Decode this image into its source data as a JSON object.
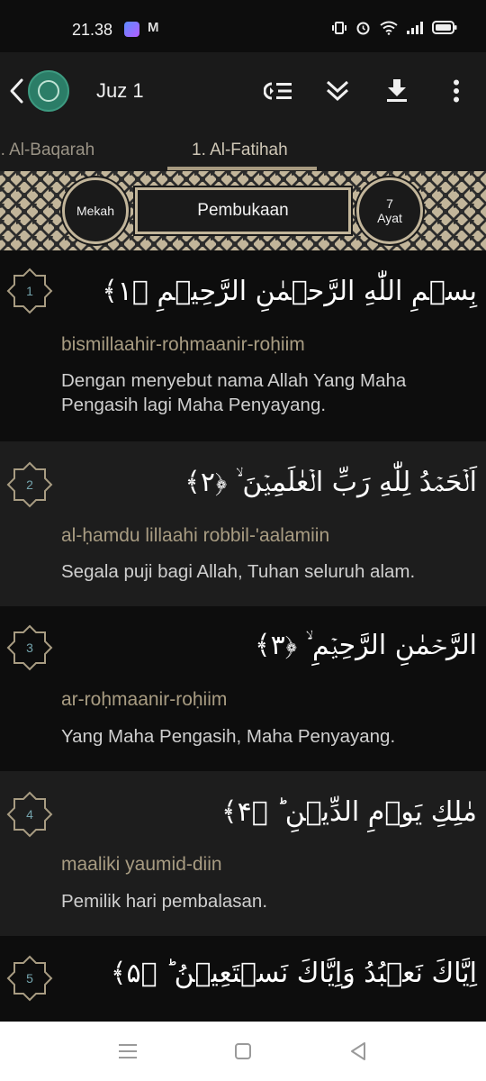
{
  "status_bar": {
    "time": "21.38",
    "mail_glyph": "M"
  },
  "app_bar": {
    "title": "Juz 1"
  },
  "tabs": [
    {
      "label": "2. Al-Baqarah"
    },
    {
      "label": "1. Al-Fatihah"
    }
  ],
  "surah_info": {
    "place": "Mekah",
    "name": "Pembukaan",
    "ayat_count": "7",
    "ayat_label": "Ayat"
  },
  "ayahs": [
    {
      "number": "1",
      "arabic": "بِسۡمِ اللّٰهِ الرَّحۡمٰنِ الرَّحِيۡمِ ﴿۱﴾",
      "translit": "bismillaahir-roḥmaanir-roḥiim",
      "translation": "Dengan menyebut nama Allah Yang Maha Pengasih lagi Maha Penyayang."
    },
    {
      "number": "2",
      "arabic": "اَلۡحَمۡدُ لِلّٰهِ رَبِّ الۡعٰلَمِيۡنَ ۙ ﴿۲﴾",
      "translit": "al-ḥamdu lillaahi robbil-'aalamiin",
      "translation": "Segala puji bagi Allah, Tuhan seluruh alam."
    },
    {
      "number": "3",
      "arabic": "الرَّحۡمٰنِ الرَّحِيۡمِ ۙ ﴿۳﴾",
      "translit": "ar-roḥmaanir-roḥiim",
      "translation": "Yang Maha Pengasih, Maha Penyayang."
    },
    {
      "number": "4",
      "arabic": "مٰلِكِ يَوۡمِ الدِّيۡنِ ؕ ﴿۴﴾",
      "translit": "maaliki yaumid-diin",
      "translation": "Pemilik hari pembalasan."
    },
    {
      "number": "5",
      "arabic": "اِيَّاكَ نَعۡبُدُ وَاِيَّاكَ نَسۡتَعِيۡنُ ؕ ﴿۵﴾",
      "translit": "",
      "translation": ""
    }
  ],
  "icons": {
    "back": "chevron-left-icon",
    "logo": "quran-logo-icon",
    "list": "playlist-icon",
    "scroll": "double-chevron-down-icon",
    "download": "download-icon",
    "more": "more-vert-icon"
  },
  "colors": {
    "background": "#0d0d0d",
    "alt_row": "#1d1d1d",
    "accent_gold": "#a89c82",
    "ayah_number": "#74a4ad",
    "logo_green": "#2b7d67"
  }
}
